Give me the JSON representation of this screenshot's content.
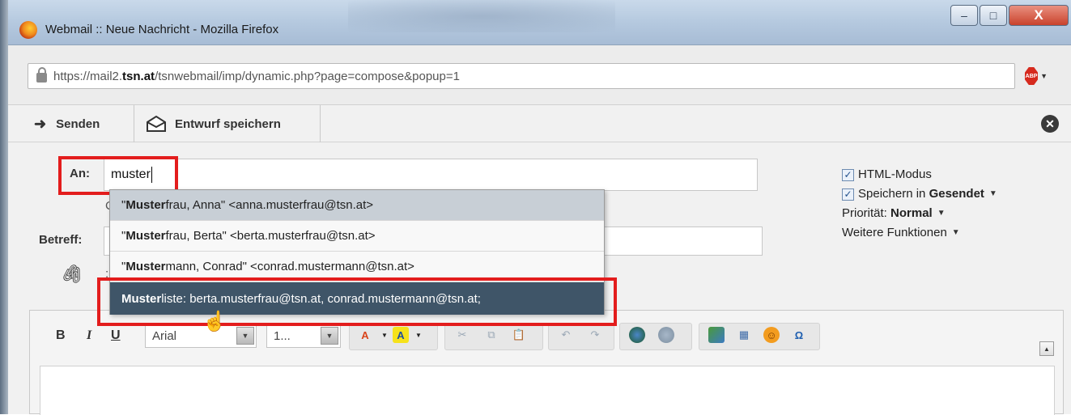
{
  "window": {
    "title": "Webmail :: Neue Nachricht - Mozilla Firefox",
    "controls": {
      "minimize": "–",
      "maximize": "□",
      "close": "X"
    }
  },
  "urlbar": {
    "url_prefix": "https://mail2.",
    "url_domain": "tsn.at",
    "url_path": "/tsnwebmail/imp/dynamic.php?page=compose&popup=1",
    "addon_label": "ABP"
  },
  "toolbar": {
    "send_label": "Senden",
    "draft_label": "Entwurf speichern"
  },
  "compose": {
    "to_label": "An:",
    "to_value": "muster",
    "cc_stub": "C",
    "subject_label": "Betreff:",
    "attachment_stub": ": A"
  },
  "options": {
    "html_mode": "HTML-Modus",
    "save_in": "Speichern in",
    "save_folder": "Gesendet",
    "priority_label": "Priorität:",
    "priority_value": "Normal",
    "more_functions": "Weitere Funktionen"
  },
  "autocomplete": {
    "items": [
      {
        "match": "Muster",
        "rest": "frau, Anna\" <anna.musterfrau@tsn.at>",
        "prefix": "\""
      },
      {
        "match": "Muster",
        "rest": "frau, Berta\" <berta.musterfrau@tsn.at>",
        "prefix": "\""
      },
      {
        "match": "Muster",
        "rest": "mann, Conrad\" <conrad.mustermann@tsn.at>",
        "prefix": "\""
      },
      {
        "match": "Muster",
        "rest": "liste: berta.musterfrau@tsn.at, conrad.mustermann@tsn.at;",
        "prefix": ""
      }
    ]
  },
  "editor": {
    "bold": "B",
    "italic": "I",
    "underline": "U",
    "font_family": "Arial",
    "font_size": "1...",
    "scroll_up": "▲"
  },
  "colors": {
    "highlight_box": "#e31d1d",
    "selected_row": "#3f5568",
    "hover_row": "#c8cfd6"
  }
}
